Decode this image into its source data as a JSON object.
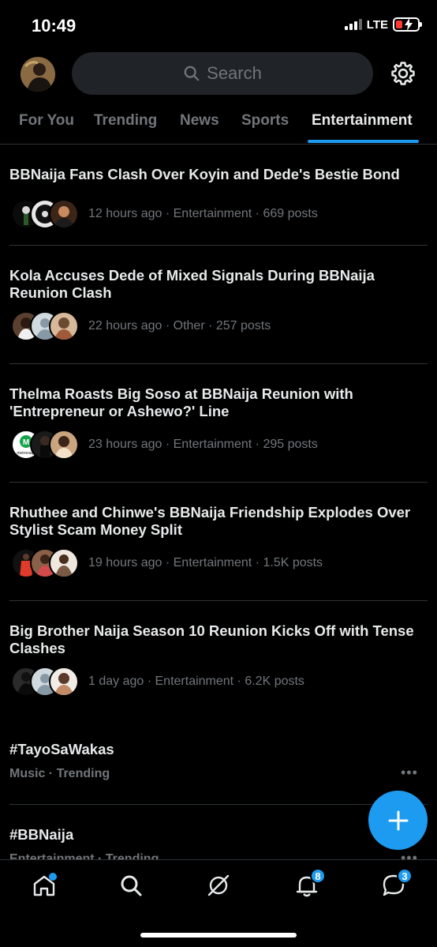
{
  "status_bar": {
    "time": "10:49",
    "network": "LTE"
  },
  "header": {
    "search_placeholder": "Search"
  },
  "tabs": [
    {
      "label": "For You"
    },
    {
      "label": "Trending"
    },
    {
      "label": "News"
    },
    {
      "label": "Sports"
    },
    {
      "label": "Entertainment"
    }
  ],
  "active_tab": "Entertainment",
  "news": [
    {
      "title": "BBNaija Fans Clash Over Koyin and Dede's Bestie Bond",
      "meta": "12 hours ago · Entertainment · 669 posts"
    },
    {
      "title": "Kola Accuses Dede of Mixed Signals During BBNaija Reunion Clash",
      "meta": "22 hours ago · Other · 257 posts"
    },
    {
      "title": "Thelma Roasts Big Soso at BBNaija Reunion with 'Entrepreneur or Ashewo?' Line",
      "meta": "23 hours ago · Entertainment · 295 posts",
      "logo_text": "metronaija"
    },
    {
      "title": "Rhuthee and Chinwe's BBNaija Friendship Explodes Over Stylist Scam Money Split",
      "meta": "19 hours ago · Entertainment · 1.5K posts"
    },
    {
      "title": "Big Brother Naija Season 10 Reunion Kicks Off with Tense Clashes",
      "meta": "1 day ago · Entertainment · 6.2K posts"
    }
  ],
  "trends": [
    {
      "name": "#TayoSaWakas",
      "meta": "Music · Trending"
    },
    {
      "name": "#BBNaija",
      "meta": "Entertainment · Trending"
    }
  ],
  "bottom_nav": {
    "notifications_badge": "8",
    "messages_badge": "3"
  },
  "colors": {
    "accent": "#1d9bf0",
    "background": "#000000",
    "muted": "#71767b",
    "divider": "#2f3336"
  }
}
